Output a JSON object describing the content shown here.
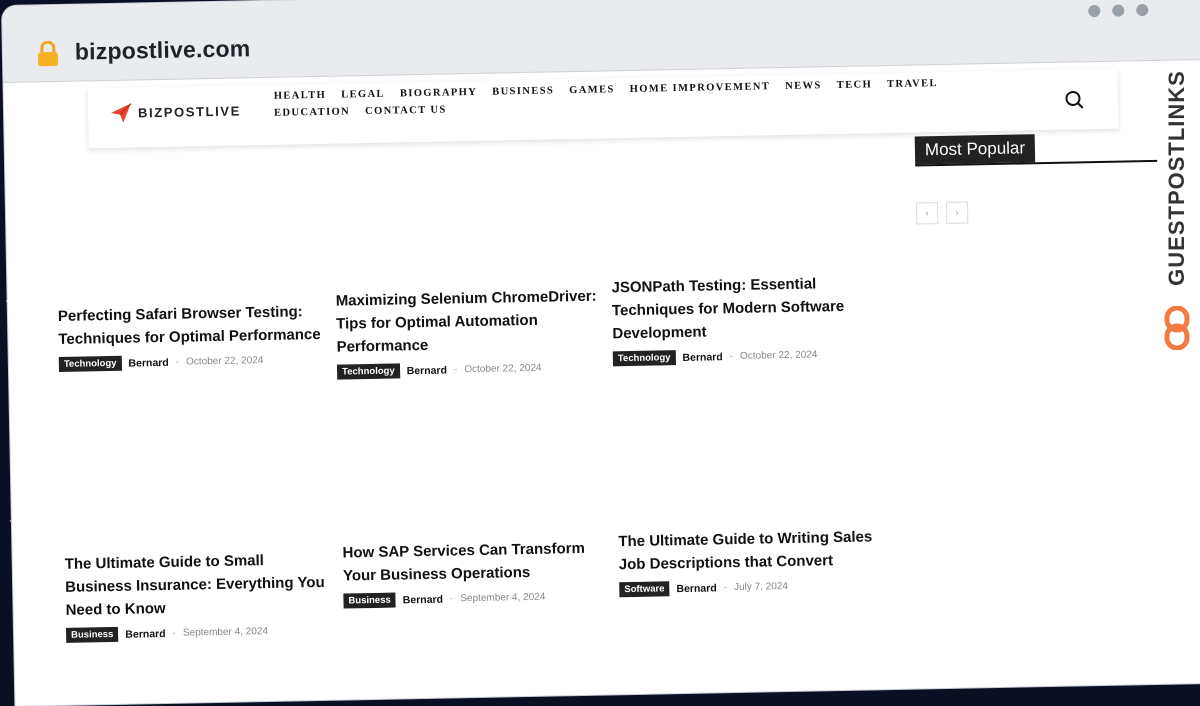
{
  "browser": {
    "url": "bizpostlive.com"
  },
  "site": {
    "logo_text": "BIZPOSTLIVE",
    "nav": [
      "Health",
      "Legal",
      "Biography",
      "Business",
      "Games",
      "Home Improvement",
      "News",
      "Tech",
      "Travel",
      "Education",
      "Contact Us"
    ]
  },
  "posts": [
    {
      "title": "Perfecting Safari Browser Testing: Techniques for Optimal Performance",
      "category": "Technology",
      "author": "Bernard",
      "date": "October 22, 2024"
    },
    {
      "title": "Maximizing Selenium ChromeDriver: Tips for Optimal Automation Performance",
      "category": "Technology",
      "author": "Bernard",
      "date": "October 22, 2024"
    },
    {
      "title": "JSONPath Testing: Essential Techniques for Modern Software Development",
      "category": "Technology",
      "author": "Bernard",
      "date": "October 22, 2024"
    },
    {
      "title": "The Ultimate Guide to Small Business Insurance: Everything You Need to Know",
      "category": "Business",
      "author": "Bernard",
      "date": "September 4, 2024"
    },
    {
      "title": "How SAP Services Can Transform Your Business Operations",
      "category": "Business",
      "author": "Bernard",
      "date": "September 4, 2024"
    },
    {
      "title": "The Ultimate Guide to Writing Sales Job Descriptions that Convert",
      "category": "Software",
      "author": "Bernard",
      "date": "July 7, 2024"
    }
  ],
  "sidebar": {
    "title": "Most Popular",
    "prev_icon": "chevron-left-icon",
    "next_icon": "chevron-right-icon"
  },
  "watermark": {
    "text": "GUESTPOSTLINKS"
  },
  "colors": {
    "accent": "#e8452c",
    "badge_bg": "#222222",
    "brand_orange": "#f47a42"
  }
}
